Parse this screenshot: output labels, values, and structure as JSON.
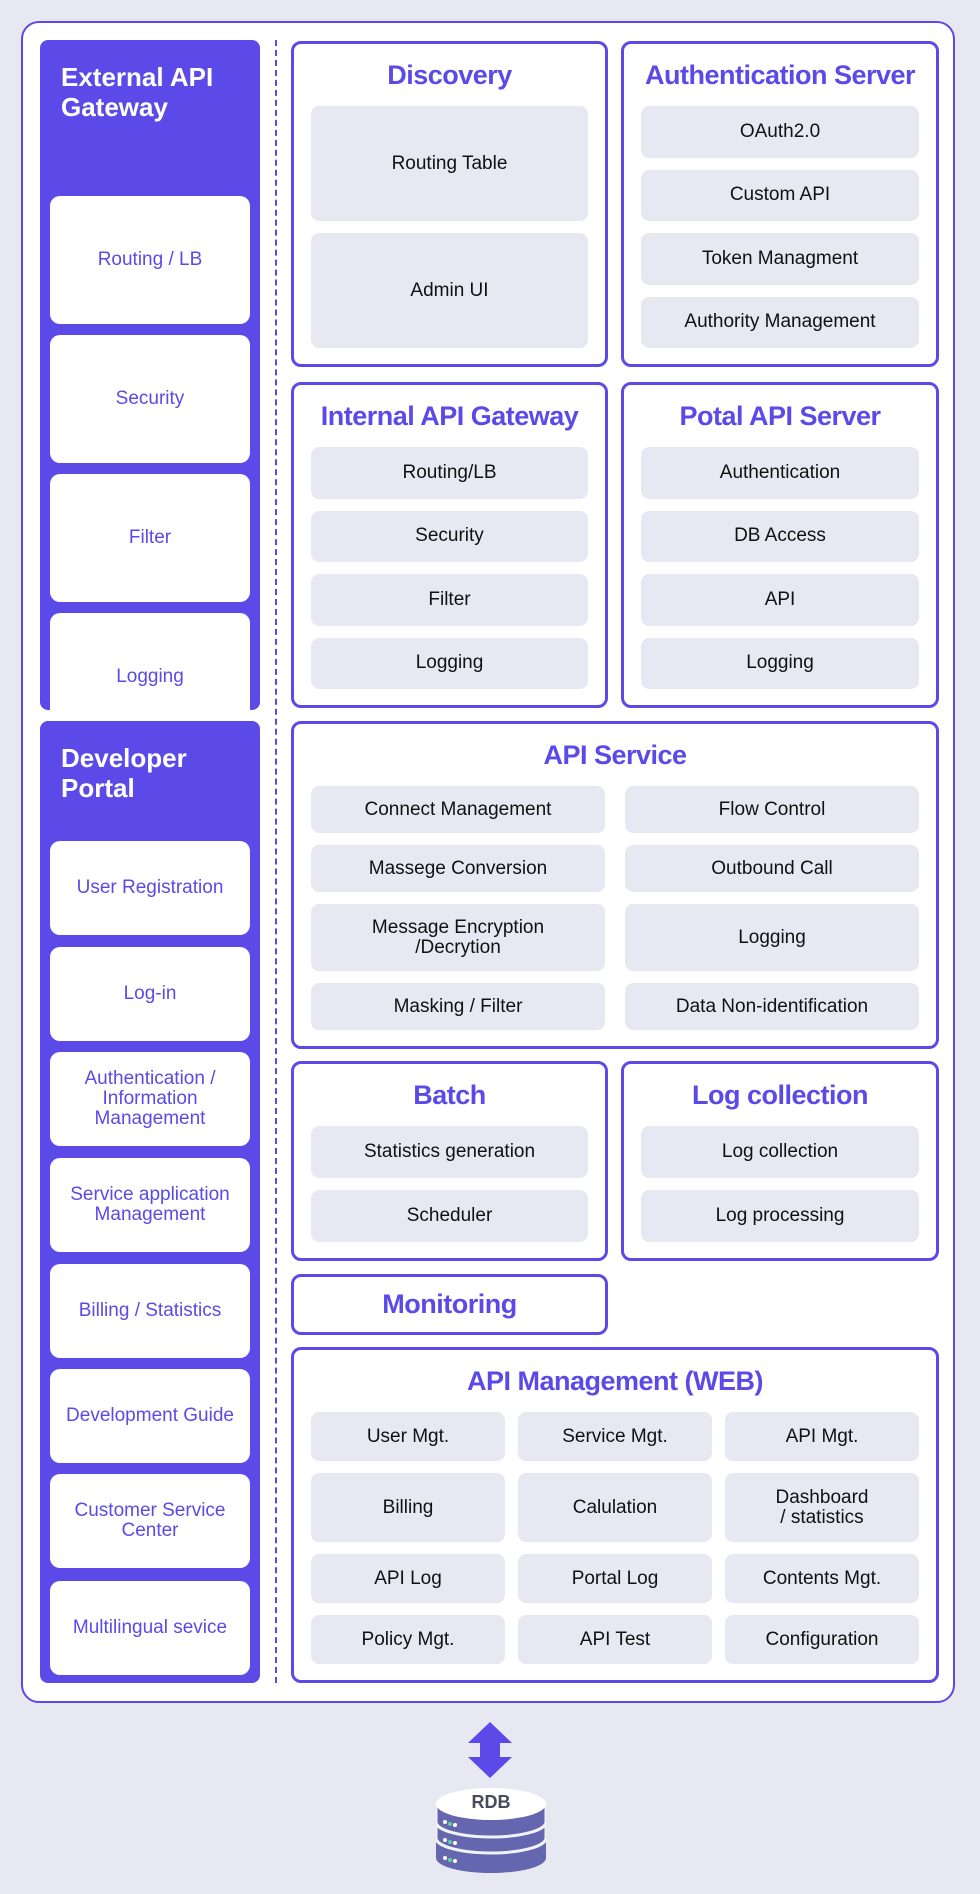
{
  "colors": {
    "accent": "#5b4ae8",
    "background": "#e8e8f3",
    "item_bg": "#e8e8f3",
    "db_body": "#6467b0"
  },
  "external_gateway": {
    "title": "External API Gateway",
    "items": [
      "Routing / LB",
      "Security",
      "Filter",
      "Logging"
    ]
  },
  "developer_portal": {
    "title": "Developer Portal",
    "items": [
      "User Registration",
      "Log-in",
      "Authentication / Information Management",
      "Service application Management",
      "Billing / Statistics",
      "Development Guide",
      "Customer Service Center",
      "Multilingual sevice"
    ]
  },
  "discovery": {
    "title": "Discovery",
    "items": [
      "Routing Table",
      "Admin UI"
    ]
  },
  "auth_server": {
    "title": "Authentication Server",
    "items": [
      "OAuth2.0",
      "Custom API",
      "Token Managment",
      "Authority Management"
    ]
  },
  "internal_gateway": {
    "title": "Internal API Gateway",
    "items": [
      "Routing/LB",
      "Security",
      "Filter",
      "Logging"
    ]
  },
  "portal_api": {
    "title": "Potal API Server",
    "items": [
      "Authentication",
      "DB Access",
      "API",
      "Logging"
    ]
  },
  "api_service": {
    "title": "API Service",
    "items": [
      "Connect Management",
      "Flow Control",
      "Massege Conversion",
      "Outbound Call",
      "Message Encryption\n/Decrytion",
      "Logging",
      "Masking / Filter",
      "Data Non-identification"
    ]
  },
  "batch": {
    "title": "Batch",
    "items": [
      "Statistics generation",
      "Scheduler"
    ]
  },
  "log_collection": {
    "title": "Log collection",
    "items": [
      "Log collection",
      "Log processing"
    ]
  },
  "monitoring": {
    "title": "Monitoring"
  },
  "api_management": {
    "title": "API Management (WEB)",
    "items": [
      "User Mgt.",
      "Service Mgt.",
      "API Mgt.",
      "Billing",
      "Calulation",
      "Dashboard\n/ statistics",
      "API Log",
      "Portal Log",
      "Contents Mgt.",
      "Policy Mgt.",
      "API Test",
      "Configuration"
    ]
  },
  "database": {
    "label": "RDB",
    "icon": "database-icon",
    "arrow": "double-arrow-vertical-icon"
  }
}
